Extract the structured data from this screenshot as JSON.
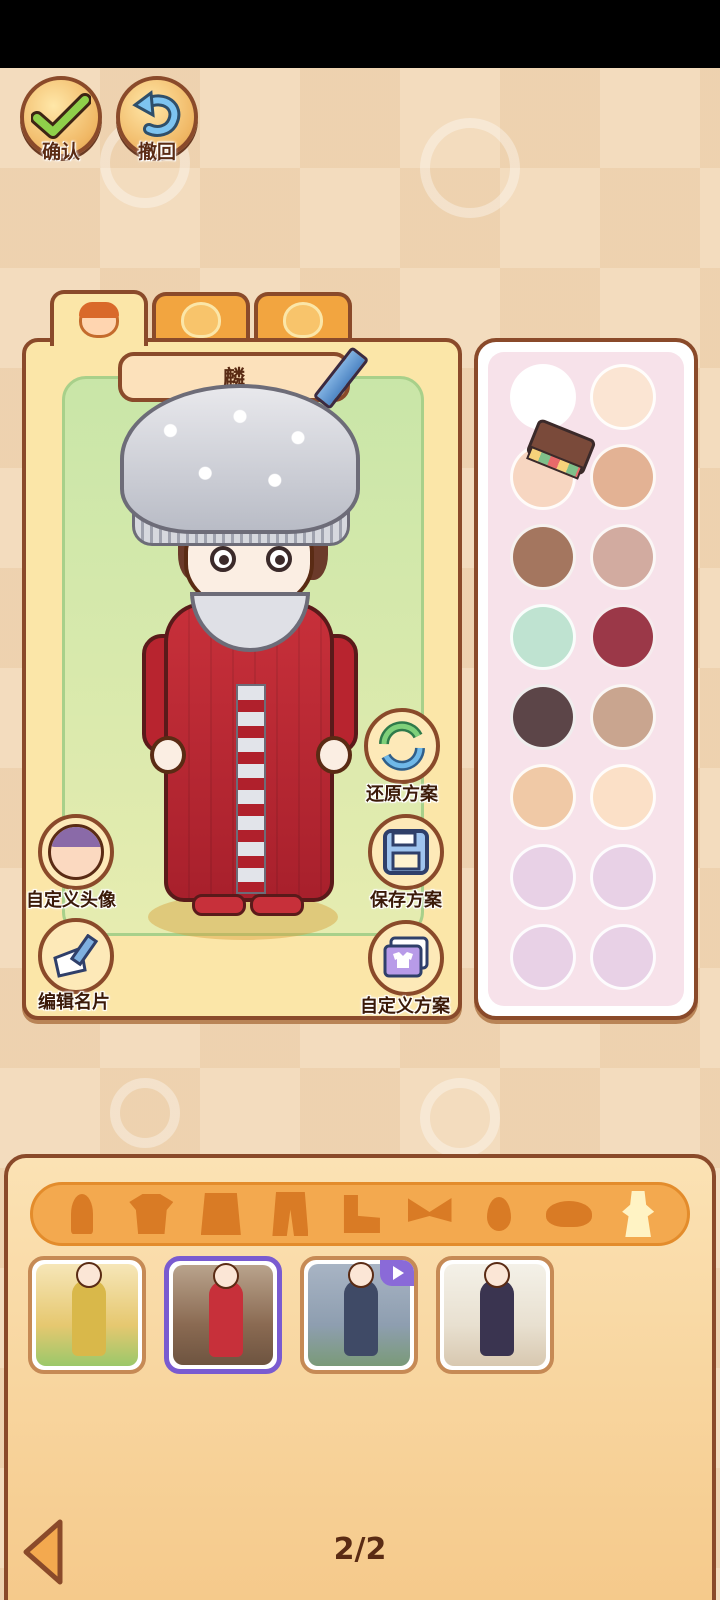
{
  "toolbar": {
    "confirm_label": "确认",
    "undo_label": "撤回"
  },
  "tabs": [
    {
      "name": "character",
      "icon": "face-icon",
      "active": true
    },
    {
      "name": "pet-cat",
      "icon": "cat-icon",
      "active": false
    },
    {
      "name": "pet-dog",
      "icon": "dog-icon",
      "active": false
    }
  ],
  "character": {
    "name": "麟"
  },
  "side_buttons": {
    "restore": "还原方案",
    "save": "保存方案",
    "custom_scheme": "自定义方案",
    "custom_avatar": "自定义头像",
    "edit_card": "编辑名片"
  },
  "palette": {
    "colors": [
      "#ffffff",
      "#fbe5d3",
      "#f7d6c1",
      "#e3b294",
      "#a4765f",
      "#d2aba0",
      "#bfe3d1",
      "#9b3848",
      "#5c4548",
      "#c9a58f",
      "#f0c9a6",
      "#fbe0c7"
    ],
    "empty_slots": 4,
    "empty_color": "#e8d1e6"
  },
  "categories": [
    {
      "name": "hair",
      "icon": "hair-icon"
    },
    {
      "name": "top",
      "icon": "shirt-icon"
    },
    {
      "name": "dress",
      "icon": "coat-icon"
    },
    {
      "name": "pants",
      "icon": "pants-icon"
    },
    {
      "name": "shoes",
      "icon": "shoe-icon"
    },
    {
      "name": "bow",
      "icon": "bow-icon"
    },
    {
      "name": "earring",
      "icon": "earring-icon"
    },
    {
      "name": "mask",
      "icon": "mask-icon"
    },
    {
      "name": "outfit",
      "icon": "outfit-icon",
      "active": true
    }
  ],
  "outfits": [
    {
      "name": "sunflower-outfit",
      "selected": false
    },
    {
      "name": "miao-silver-outfit",
      "selected": true
    },
    {
      "name": "silver-crown-outfit",
      "selected": false,
      "video_badge": true
    },
    {
      "name": "pirate-outfit",
      "selected": false
    }
  ],
  "pager": {
    "text": "2/2"
  }
}
